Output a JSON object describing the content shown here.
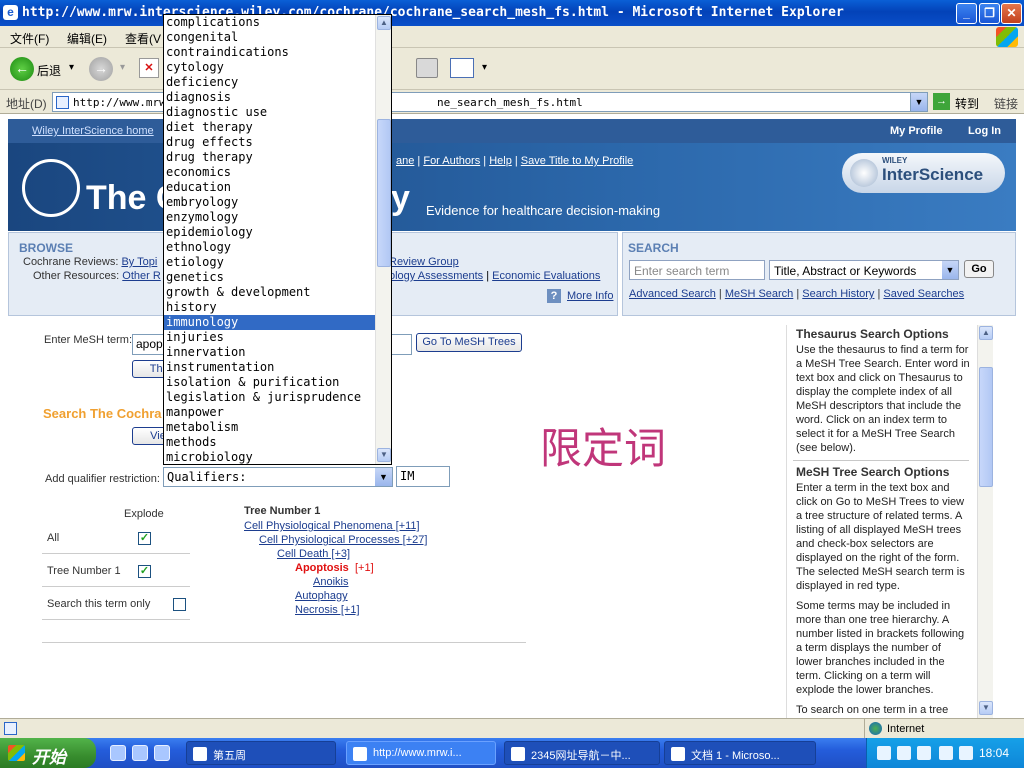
{
  "window": {
    "title": "http://www.mrw.interscience.wiley.com/cochrane/cochrane_search_mesh_fs.html - Microsoft Internet Explorer",
    "icon": "ie-icon",
    "minimize": "_",
    "maximize": "❐",
    "close": "✕"
  },
  "menu": {
    "file": "文件(F)",
    "edit": "编辑(E)",
    "view": "查看(V"
  },
  "toolbar": {
    "back": "后退",
    "back_glyph": "←",
    "forward_glyph": "→",
    "stop_glyph": "✕",
    "dropdown": "▾"
  },
  "address": {
    "label": "地址(D)",
    "url": "http://www.mrw.",
    "url_tail": "ne_search_mesh_fs.html",
    "go_glyph": "→",
    "go": "转到",
    "links": "链接"
  },
  "header": {
    "home_link": "Wiley InterScience home",
    "my_profile": "My Profile",
    "login": "Log In",
    "brand_left": "The C",
    "brand_right": "y",
    "tagline": "Evidence for healthcare decision-making",
    "top_links": [
      "ane",
      "For Authors",
      "Help",
      "Save Title to My Profile"
    ],
    "wiley_small": "WILEY",
    "wiley_big": "InterScience"
  },
  "browse": {
    "heading": "BROWSE",
    "row1_label": "Cochrane Reviews:",
    "row1_link": "By Topi",
    "row1_tail": "Review Group",
    "row2_label": "Other Resources:",
    "row2_link": "Other R",
    "row2_tail_a": "ology Assessments",
    "row2_tail_b": "Economic Evaluations",
    "help_glyph": "?",
    "more_info": "More Info"
  },
  "search": {
    "heading": "SEARCH",
    "placeholder": "Enter search term",
    "field_select": "Title, Abstract or Keywords",
    "go": "Go",
    "links": [
      "Advanced Search",
      "MeSH Search",
      "Search History",
      "Saved Searches"
    ]
  },
  "mesh": {
    "enter_label": "Enter MeSH term:",
    "term_value": "apop",
    "go_trees": "Go To MeSH Trees",
    "thesaurus_btn": "Thes",
    "search_heading": "Search The Cochra",
    "view_btn": "View",
    "qualifier_label": "Add qualifier restriction:",
    "qualifier_value": "Qualifiers:",
    "qualifier_code": "IM",
    "annotation": "限定词"
  },
  "explode": {
    "header": "Explode",
    "rows": [
      {
        "label": "All",
        "checked": "✓"
      },
      {
        "label": "Tree Number 1",
        "checked": "✓"
      },
      {
        "label": "Search this term only",
        "checked": ""
      }
    ]
  },
  "tree": {
    "heading": "Tree Number 1",
    "items": [
      "Cell Physiological Phenomena [+11]",
      "Cell Physiological Processes [+27]",
      "Cell Death [+3]",
      "Apoptosis",
      "[+1]",
      "Anoikis",
      "Autophagy",
      "Necrosis [+1]"
    ]
  },
  "help_panel": {
    "thesaurus_heading": "Thesaurus Search Options",
    "thesaurus_text": "Use the thesaurus to find a term for a MeSH Tree Search. Enter word in text box and click on Thesaurus to display the complete index of all MeSH descriptors that include the word. Click on an index term to select it for a MeSH Tree Search (see below).",
    "tree_heading": "MeSH Tree Search Options",
    "tree_text": "Enter a term in the text box and click on Go to MeSH Trees to view a tree structure of related terms. A listing of all displayed MeSH trees and check-box selectors are displayed on the right of the form. The selected MeSH search term is displayed in red type.",
    "para3": "Some terms may be included in more than one tree hierarchy. A number listed in brackets following a term displays the number of lower branches included in the term. Clicking on a term will explode the lower branches.",
    "para4": "To search on one term in a tree"
  },
  "qualifiers": {
    "selected_index": 20,
    "options": [
      "complications",
      "congenital",
      "contraindications",
      "cytology",
      "deficiency",
      "diagnosis",
      "diagnostic use",
      "diet therapy",
      "drug effects",
      "drug therapy",
      "economics",
      "education",
      "embryology",
      "enzymology",
      "epidemiology",
      "ethnology",
      "etiology",
      "genetics",
      "growth & development",
      "history",
      "immunology",
      "injuries",
      "innervation",
      "instrumentation",
      "isolation & purification",
      "legislation & jurisprudence",
      "manpower",
      "metabolism",
      "methods",
      "microbiology"
    ]
  },
  "scroll": {
    "up": "▲",
    "down": "▼",
    "dd": "▼"
  },
  "status": {
    "zone": "Internet"
  },
  "taskbar": {
    "start": "开始",
    "tasks": [
      "第五周",
      "http://www.mrw.i...",
      "2345网址导航－中...",
      "文档 1 - Microso..."
    ],
    "clock": "18:04"
  }
}
